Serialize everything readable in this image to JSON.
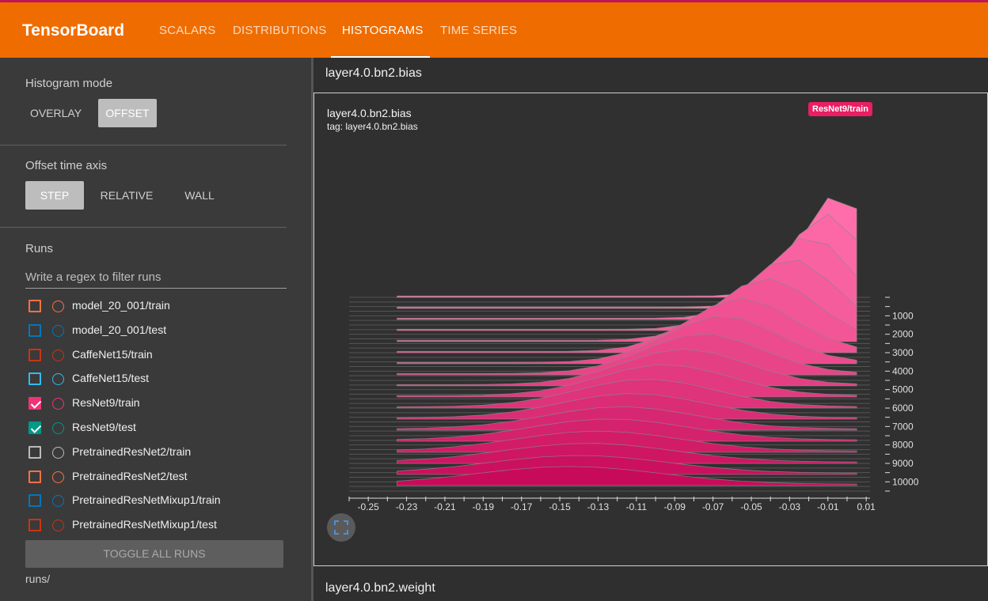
{
  "app": {
    "title": "TensorBoard",
    "tabs": [
      {
        "label": "SCALARS"
      },
      {
        "label": "DISTRIBUTIONS"
      },
      {
        "label": "HISTOGRAMS",
        "active": true
      },
      {
        "label": "TIME SERIES"
      }
    ]
  },
  "sidebar": {
    "histogram_mode": {
      "title": "Histogram mode",
      "options": [
        "OVERLAY",
        "OFFSET"
      ],
      "selected": "OFFSET"
    },
    "offset_time_axis": {
      "title": "Offset time axis",
      "options": [
        "STEP",
        "RELATIVE",
        "WALL"
      ],
      "selected": "STEP"
    },
    "runs": {
      "title": "Runs",
      "filter_placeholder": "Write a regex to filter runs",
      "items": [
        {
          "name": "model_20_001/train",
          "color": "#ff7043",
          "checked": false
        },
        {
          "name": "model_20_001/test",
          "color": "#0077bb",
          "checked": false
        },
        {
          "name": "CaffeNet15/train",
          "color": "#cc3311",
          "checked": false
        },
        {
          "name": "CaffeNet15/test",
          "color": "#33bbee",
          "checked": false
        },
        {
          "name": "ResNet9/train",
          "color": "#ee3377",
          "checked": true
        },
        {
          "name": "ResNet9/test",
          "color": "#009988",
          "checked": true
        },
        {
          "name": "PretrainedResNet2/train",
          "color": "#bbbbbb",
          "checked": false
        },
        {
          "name": "PretrainedResNet2/test",
          "color": "#ff7043",
          "checked": false
        },
        {
          "name": "PretrainedResNetMixup1/train",
          "color": "#0077bb",
          "checked": false
        },
        {
          "name": "PretrainedResNetMixup1/test",
          "color": "#cc3311",
          "checked": false
        }
      ],
      "toggle_all_label": "TOGGLE ALL RUNS",
      "log_dir": "runs/"
    }
  },
  "main": {
    "groups": [
      {
        "title": "layer4.0.bn2.bias"
      },
      {
        "title": "layer4.0.bn2.weight"
      }
    ],
    "card": {
      "title": "layer4.0.bn2.bias",
      "tag": "tag: layer4.0.bn2.bias",
      "run_badge": "ResNet9/train",
      "expand_icon": "fullscreen-icon"
    }
  },
  "chart_data": {
    "type": "histogram-offset",
    "run": "ResNet9/train",
    "series_color": "#e91e63",
    "x_ticks": [
      -0.25,
      -0.23,
      -0.21,
      -0.19,
      -0.17,
      -0.15,
      -0.13,
      -0.11,
      -0.09,
      -0.07,
      -0.05,
      -0.03,
      -0.01,
      0.01
    ],
    "xlim": [
      -0.26,
      0.012
    ],
    "y_ticks": [
      1000,
      2000,
      3000,
      4000,
      5000,
      6000,
      7000,
      8000,
      9000,
      10000
    ],
    "ylim": [
      0,
      10500
    ],
    "steps": [
      0,
      600,
      1200,
      1800,
      2400,
      3000,
      3600,
      4200,
      4800,
      5400,
      6000,
      6600,
      7200,
      7800,
      8400,
      9000,
      9600,
      10200
    ],
    "x_bins": [
      -0.235,
      -0.22,
      -0.205,
      -0.19,
      -0.175,
      -0.16,
      -0.145,
      -0.13,
      -0.115,
      -0.1,
      -0.085,
      -0.07,
      -0.055,
      -0.04,
      -0.025,
      -0.01,
      0.005
    ],
    "peak_x": [
      -0.005,
      -0.011,
      -0.02,
      -0.03,
      -0.042,
      -0.055,
      -0.065,
      -0.075,
      -0.085,
      -0.095,
      -0.105,
      -0.112,
      -0.118,
      -0.124,
      -0.13,
      -0.135,
      -0.14,
      -0.145
    ],
    "peak_density": [
      4.6,
      4.2,
      3.7,
      3.2,
      2.8,
      2.4,
      2.1,
      1.8,
      1.6,
      1.4,
      1.25,
      1.1,
      1.0,
      0.95,
      0.9,
      0.85,
      0.8,
      0.8
    ]
  }
}
